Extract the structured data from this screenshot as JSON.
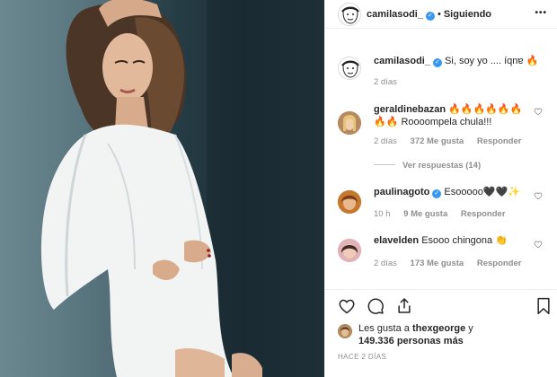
{
  "header": {
    "username": "camilasodi_",
    "separator": "•",
    "follow_label": "Siguiendo",
    "more_label": "•••"
  },
  "caption": {
    "username": "camilasodi_",
    "text": "Si, soy yo .... íqnɐ",
    "emoji": "🔥",
    "time": "2 días"
  },
  "comments": [
    {
      "username": "geraldinebazan",
      "line1": "🔥🔥🔥🔥🔥🔥",
      "line2_emoji": "🔥🔥",
      "line2_text": "Roooompela chula!!!",
      "time": "2 días",
      "likes": "372 Me gusta",
      "reply": "Responder",
      "view_replies": "Ver respuestas (14)"
    },
    {
      "username": "paulinagoto",
      "text": "Esooooo🖤🖤✨",
      "time": "10 h",
      "likes": "9 Me gusta",
      "reply": "Responder"
    },
    {
      "username": "elavelden",
      "text": "Esooo chingona 👏",
      "time": "2 días",
      "likes": "173 Me gusta",
      "reply": "Responder"
    }
  ],
  "likes": {
    "line1_prefix": "Les gusta a ",
    "user": "thexgeorge",
    "line1_suffix": " y",
    "line2": "149.336 personas más"
  },
  "posted": "HACE 2 DÍAS",
  "colors": {
    "verified": "#3897f0",
    "muted": "#8e8e8e",
    "text": "#262626",
    "border": "#efefef"
  }
}
